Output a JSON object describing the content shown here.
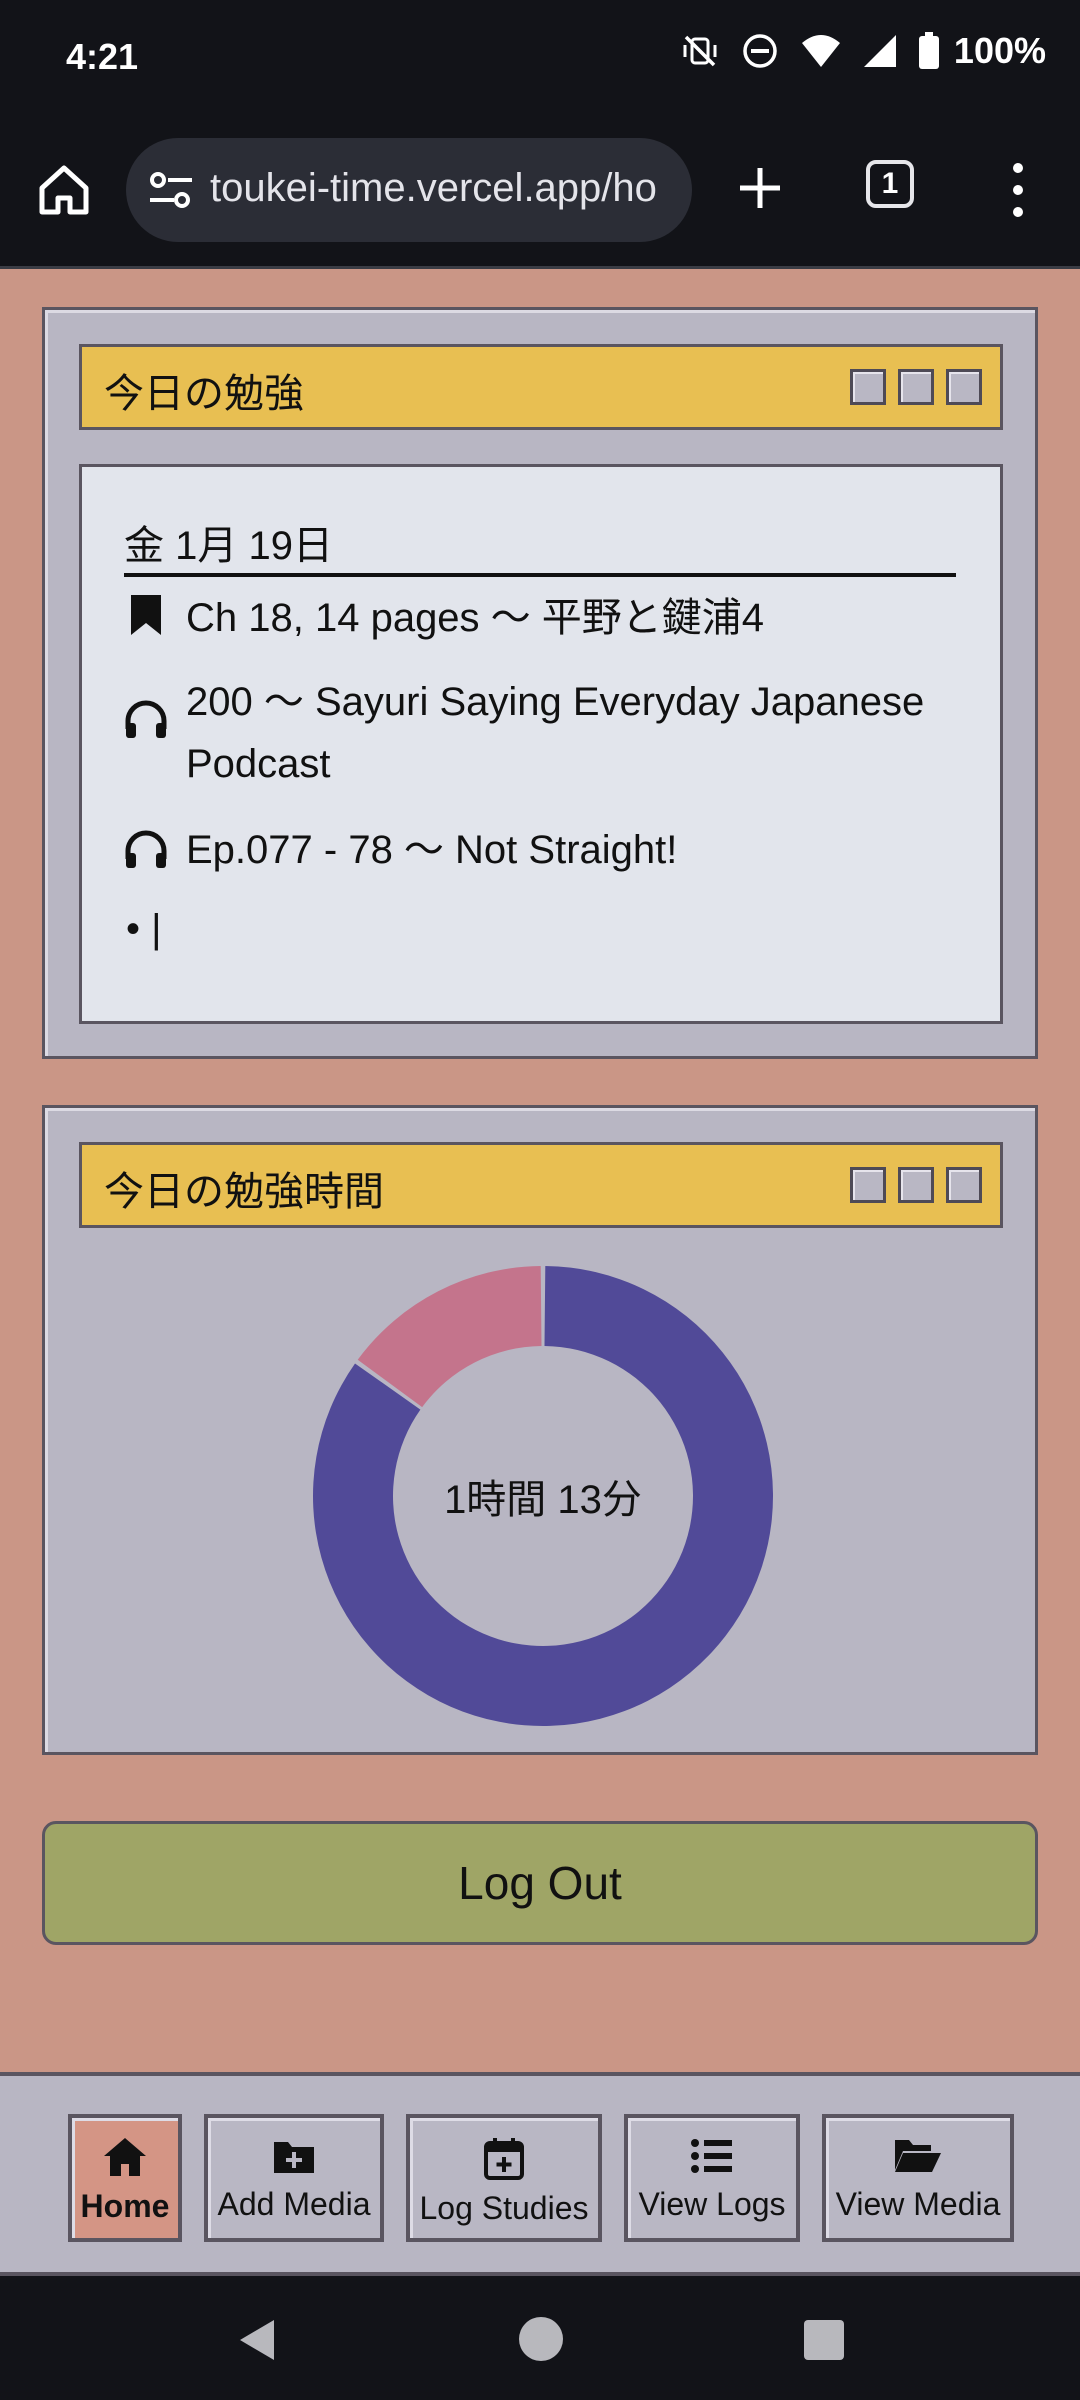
{
  "status": {
    "time": "4:21",
    "battery": "100%"
  },
  "browser": {
    "url": "toukei-time.vercel.app/ho",
    "tab_count": "1"
  },
  "study_panel": {
    "title": "今日の勉強",
    "date": "金 1月 19日",
    "entries": [
      {
        "icon": "bookmark-icon",
        "text": "Ch 18, 14 pages 〜 平野と鍵浦4"
      },
      {
        "icon": "headphones-icon",
        "text": "200 〜 Sayuri Saying Everyday Japanese Podcast"
      },
      {
        "icon": "headphones-icon",
        "text": "Ep.077 - 78 〜 Not Straight!"
      }
    ],
    "bullet_placeholder": "• |"
  },
  "time_panel": {
    "title": "今日の勉強時間",
    "total": "1時間 13分"
  },
  "chart_data": {
    "type": "pie",
    "variant": "donut",
    "values": [
      62,
      11
    ],
    "colors": [
      "#514a98",
      "#c4748c"
    ],
    "center_label": "1時間 13分"
  },
  "logout_label": "Log Out",
  "nav": [
    {
      "label": "Home",
      "icon": "home-icon",
      "active": true
    },
    {
      "label": "Add Media",
      "icon": "folder-plus-icon"
    },
    {
      "label": "Log Studies",
      "icon": "calendar-plus-icon"
    },
    {
      "label": "View Logs",
      "icon": "list-icon"
    },
    {
      "label": "View Media",
      "icon": "folder-open-icon"
    }
  ]
}
